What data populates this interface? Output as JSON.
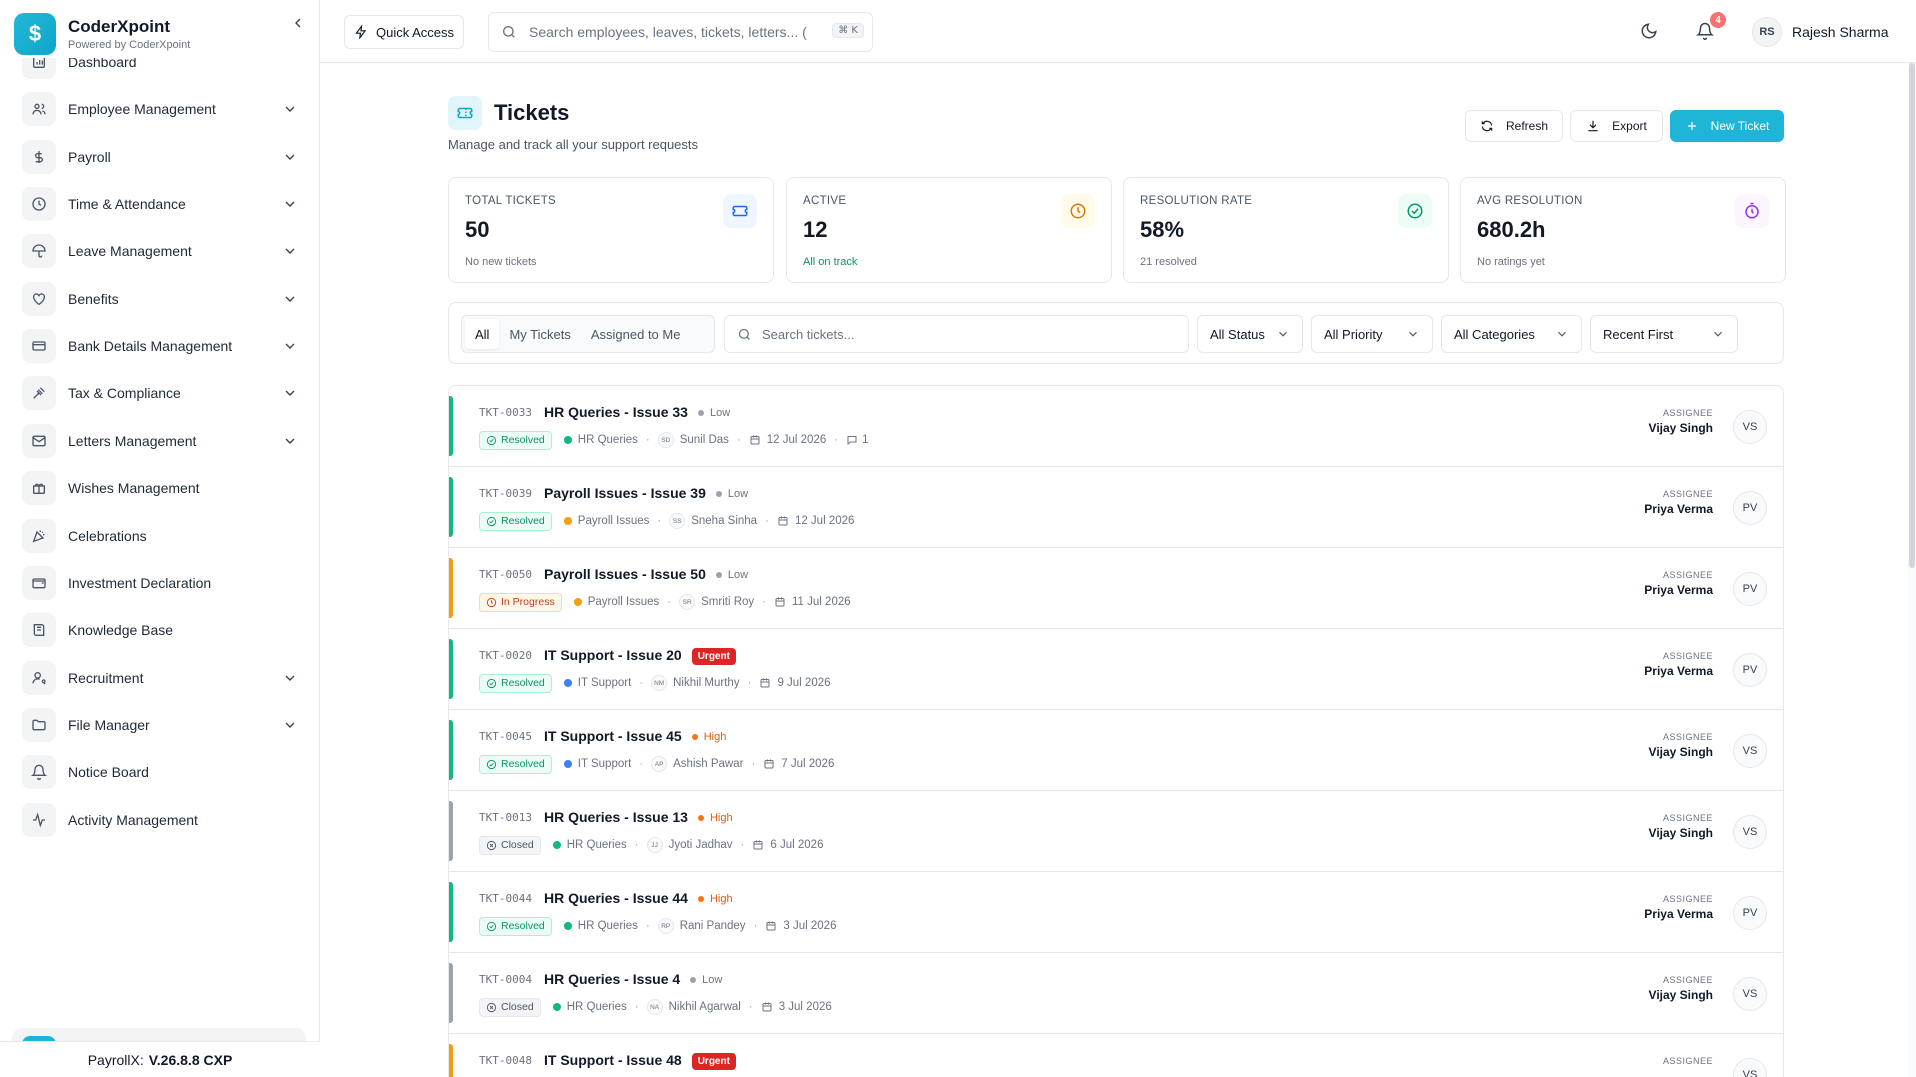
{
  "brand": {
    "name": "CoderXpoint",
    "sub": "Powered by CoderXpoint"
  },
  "sidebar": {
    "items": [
      {
        "label": "Dashboard",
        "icon": "dashboard-icon",
        "expandable": false
      },
      {
        "label": "Employee Management",
        "icon": "users-icon",
        "expandable": true
      },
      {
        "label": "Payroll",
        "icon": "dollar-icon",
        "expandable": true
      },
      {
        "label": "Time & Attendance",
        "icon": "clock-icon",
        "expandable": true
      },
      {
        "label": "Leave Management",
        "icon": "umbrella-icon",
        "expandable": true
      },
      {
        "label": "Benefits",
        "icon": "heart-hand-icon",
        "expandable": true
      },
      {
        "label": "Bank Details Management",
        "icon": "card-icon",
        "expandable": true
      },
      {
        "label": "Tax & Compliance",
        "icon": "gavel-icon",
        "expandable": true
      },
      {
        "label": "Letters Management",
        "icon": "mail-icon",
        "expandable": true
      },
      {
        "label": "Wishes Management",
        "icon": "gift-icon",
        "expandable": false
      },
      {
        "label": "Celebrations",
        "icon": "party-icon",
        "expandable": false
      },
      {
        "label": "Investment Declaration",
        "icon": "wallet-icon",
        "expandable": false
      },
      {
        "label": "Knowledge Base",
        "icon": "book-icon",
        "expandable": false
      },
      {
        "label": "Recruitment",
        "icon": "user-search-icon",
        "expandable": true
      },
      {
        "label": "File Manager",
        "icon": "folder-icon",
        "expandable": true
      },
      {
        "label": "Notice Board",
        "icon": "bell-icon",
        "expandable": false
      },
      {
        "label": "Activity Management",
        "icon": "activity-icon",
        "expandable": false
      }
    ],
    "footer_prefix": "PayrollX:",
    "footer_version": "V.26.8.8 CXP"
  },
  "topbar": {
    "quick_access": "Quick Access",
    "search_placeholder": "Search employees, leaves, tickets, letters... (",
    "shortcut": "⌘ K",
    "notifications": "4",
    "user_initials": "RS",
    "user_name": "Rajesh Sharma"
  },
  "page": {
    "title": "Tickets",
    "subtitle": "Manage and track all your support requests",
    "refresh": "Refresh",
    "export": "Export",
    "new_ticket": "New Ticket"
  },
  "stats": [
    {
      "label": "TOTAL TICKETS",
      "value": "50",
      "note": "No new tickets",
      "note_ok": false,
      "icon": "ticket-icon",
      "color": "#2563eb",
      "bg": "#eff6ff"
    },
    {
      "label": "ACTIVE",
      "value": "12",
      "note": "All on track",
      "note_ok": true,
      "icon": "clock-icon",
      "color": "#d97706",
      "bg": "#fffbeb"
    },
    {
      "label": "RESOLUTION RATE",
      "value": "58%",
      "note": "21 resolved",
      "note_ok": false,
      "icon": "check-circle-icon",
      "color": "#059669",
      "bg": "#ecfdf5"
    },
    {
      "label": "AVG RESOLUTION",
      "value": "680.2h",
      "note": "No ratings yet",
      "note_ok": false,
      "icon": "timer-icon",
      "color": "#9333ea",
      "bg": "#faf5ff"
    }
  ],
  "filters": {
    "tabs": [
      "All",
      "My Tickets",
      "Assigned to Me"
    ],
    "active_tab": 0,
    "search_placeholder": "Search tickets...",
    "status": "All Status",
    "priority": "All Priority",
    "category": "All Categories",
    "sort": "Recent First"
  },
  "assignee_label": "ASSIGNEE",
  "tickets": [
    {
      "id": "TKT-0033",
      "title": "HR Queries - Issue 33",
      "priority": "Low",
      "status": "Resolved",
      "category": "HR Queries",
      "cat_color": "#10b981",
      "reporter_initials": "SD",
      "reporter": "Sunil Das",
      "date": "12 Jul 2026",
      "comments": "1",
      "assignee": "Vijay Singh",
      "assignee_initials": "VS",
      "bar": "#10b981"
    },
    {
      "id": "TKT-0039",
      "title": "Payroll Issues - Issue 39",
      "priority": "Low",
      "status": "Resolved",
      "category": "Payroll Issues",
      "cat_color": "#f59e0b",
      "reporter_initials": "SS",
      "reporter": "Sneha Sinha",
      "date": "12 Jul 2026",
      "comments": "",
      "assignee": "Priya Verma",
      "assignee_initials": "PV",
      "bar": "#10b981"
    },
    {
      "id": "TKT-0050",
      "title": "Payroll Issues - Issue 50",
      "priority": "Low",
      "status": "In Progress",
      "category": "Payroll Issues",
      "cat_color": "#f59e0b",
      "reporter_initials": "SR",
      "reporter": "Smriti Roy",
      "date": "11 Jul 2026",
      "comments": "",
      "assignee": "Priya Verma",
      "assignee_initials": "PV",
      "bar": "#f59e0b"
    },
    {
      "id": "TKT-0020",
      "title": "IT Support - Issue 20",
      "priority": "Urgent",
      "status": "Resolved",
      "category": "IT Support",
      "cat_color": "#3b82f6",
      "reporter_initials": "NM",
      "reporter": "Nikhil Murthy",
      "date": "9 Jul 2026",
      "comments": "",
      "assignee": "Priya Verma",
      "assignee_initials": "PV",
      "bar": "#10b981"
    },
    {
      "id": "TKT-0045",
      "title": "IT Support - Issue 45",
      "priority": "High",
      "status": "Resolved",
      "category": "IT Support",
      "cat_color": "#3b82f6",
      "reporter_initials": "AP",
      "reporter": "Ashish Pawar",
      "date": "7 Jul 2026",
      "comments": "",
      "assignee": "Vijay Singh",
      "assignee_initials": "VS",
      "bar": "#10b981"
    },
    {
      "id": "TKT-0013",
      "title": "HR Queries - Issue 13",
      "priority": "High",
      "status": "Closed",
      "category": "HR Queries",
      "cat_color": "#10b981",
      "reporter_initials": "JJ",
      "reporter": "Jyoti Jadhav",
      "date": "6 Jul 2026",
      "comments": "",
      "assignee": "Vijay Singh",
      "assignee_initials": "VS",
      "bar": "#9ca3af"
    },
    {
      "id": "TKT-0044",
      "title": "HR Queries - Issue 44",
      "priority": "High",
      "status": "Resolved",
      "category": "HR Queries",
      "cat_color": "#10b981",
      "reporter_initials": "RP",
      "reporter": "Rani Pandey",
      "date": "3 Jul 2026",
      "comments": "",
      "assignee": "Priya Verma",
      "assignee_initials": "PV",
      "bar": "#10b981"
    },
    {
      "id": "TKT-0004",
      "title": "HR Queries - Issue 4",
      "priority": "Low",
      "status": "Closed",
      "category": "HR Queries",
      "cat_color": "#10b981",
      "reporter_initials": "NA",
      "reporter": "Nikhil Agarwal",
      "date": "3 Jul 2026",
      "comments": "",
      "assignee": "Vijay Singh",
      "assignee_initials": "VS",
      "bar": "#9ca3af"
    },
    {
      "id": "TKT-0048",
      "title": "IT Support - Issue 48",
      "priority": "Urgent",
      "status": "",
      "category": "",
      "cat_color": "#3b82f6",
      "reporter_initials": "",
      "reporter": "",
      "date": "",
      "comments": "",
      "assignee": "",
      "assignee_initials": "VS",
      "bar": "#f59e0b"
    }
  ]
}
